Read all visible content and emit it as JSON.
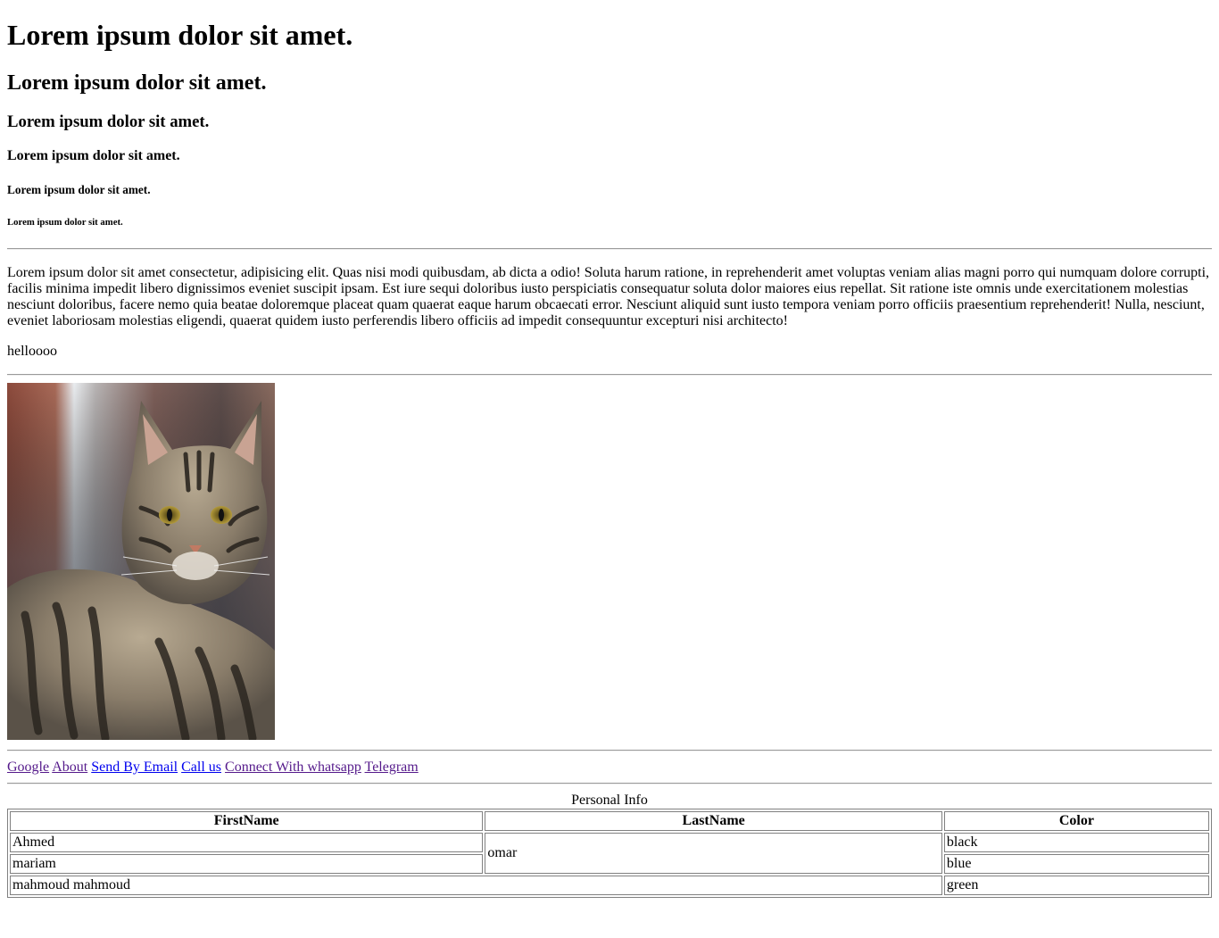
{
  "headings": {
    "h1": "Lorem ipsum dolor sit amet.",
    "h2": "Lorem ipsum dolor sit amet.",
    "h3": "Lorem ipsum dolor sit amet.",
    "h4": "Lorem ipsum dolor sit amet.",
    "h5": "Lorem ipsum dolor sit amet.",
    "h6": "Lorem ipsum dolor sit amet."
  },
  "body": {
    "paragraph": "Lorem ipsum dolor sit amet consectetur, adipisicing elit. Quas nisi modi quibusdam, ab dicta a odio! Soluta harum ratione, in reprehenderit amet voluptas veniam alias magni porro qui numquam dolore corrupti, facilis minima impedit libero dignissimos eveniet suscipit ipsam. Est iure sequi doloribus iusto perspiciatis consequatur soluta dolor maiores eius repellat. Sit ratione iste omnis unde exercitationem molestias nesciunt doloribus, facere nemo quia beatae doloremque placeat quam quaerat eaque harum obcaecati error. Nesciunt aliquid sunt iusto tempora veniam porro officiis praesentium reprehenderit! Nulla, nesciunt, eveniet laboriosam molestias eligendi, quaerat quidem iusto perferendis libero officiis ad impedit consequuntur excepturi nisi architecto!",
    "hello": "helloooo"
  },
  "image": {
    "icon": "cat-photo"
  },
  "links": [
    {
      "label": "Google",
      "visited": true
    },
    {
      "label": "About",
      "visited": true
    },
    {
      "label": "Send By Email",
      "visited": false
    },
    {
      "label": "Call us",
      "visited": false
    },
    {
      "label": "Connect With whatsapp",
      "visited": true
    },
    {
      "label": "Telegram",
      "visited": true
    }
  ],
  "colors": {
    "link_unvisited": "#0000ee",
    "link_visited": "#551a8b",
    "border": "#808080"
  },
  "table": {
    "caption": "Personal Info",
    "headers": [
      "FirstName",
      "LastName",
      "Color"
    ],
    "rows": [
      {
        "first": "Ahmed",
        "last": "omar",
        "color": "black"
      },
      {
        "first": "mariam",
        "color": "blue"
      },
      {
        "first": "mahmoud mahmoud",
        "color": "green"
      }
    ]
  }
}
